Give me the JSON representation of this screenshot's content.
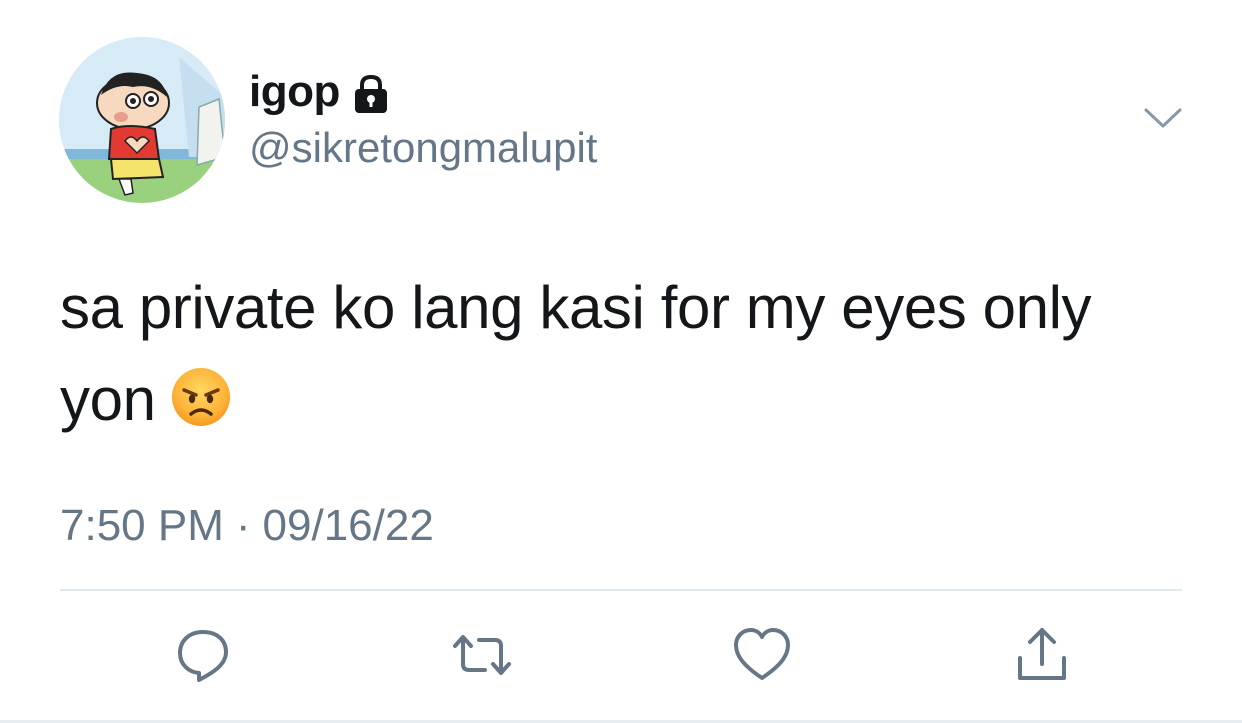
{
  "user": {
    "display_name": "igop",
    "handle": "@sikretongmalupit",
    "protected_icon": "lock-icon",
    "avatar_icon": "cartoon-avatar"
  },
  "tweet": {
    "text": "sa private ko lang kasi for my eyes only yon",
    "emoji": "angry-face-emoji",
    "time": "7:50 PM",
    "separator": "·",
    "date": "09/16/22"
  },
  "actions": {
    "reply": "reply-icon",
    "retweet": "retweet-icon",
    "like": "heart-icon",
    "share": "share-icon",
    "more": "chevron-down-icon"
  },
  "colors": {
    "text": "#14171a",
    "secondary": "#657786",
    "divider": "#e1e8ed"
  }
}
